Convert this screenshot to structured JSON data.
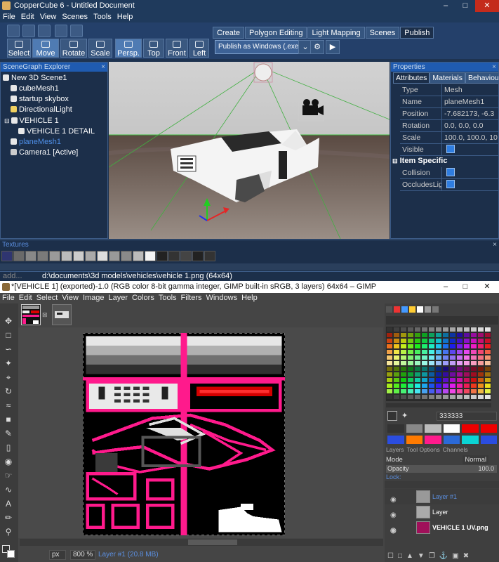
{
  "coppercube": {
    "title": "CopperCube 6 - Untitled Document",
    "menu": [
      "File",
      "Edit",
      "View",
      "Scenes",
      "Tools",
      "Help"
    ],
    "tools": [
      "Select",
      "Move",
      "Rotate",
      "Scale",
      "Persp.",
      "Top",
      "Front",
      "Left"
    ],
    "active_tools": [
      "Move",
      "Persp."
    ],
    "ribbon_tabs": [
      "Create",
      "Polygon Editing",
      "Light Mapping",
      "Scenes",
      "Publish"
    ],
    "selected_ribbon_tab": "Publish",
    "publish_target": "Publish as Windows (.exe)",
    "scene_graph": {
      "title": "SceneGraph Explorer",
      "items": [
        {
          "label": "New 3D Scene1",
          "indent": 0
        },
        {
          "label": "cubeMesh1",
          "indent": 1
        },
        {
          "label": "startup skybox",
          "indent": 1
        },
        {
          "label": "DirectionalLight",
          "indent": 1
        },
        {
          "label": "VEHICLE 1",
          "indent": 1
        },
        {
          "label": "VEHICLE 1 DETAIL",
          "indent": 2
        },
        {
          "label": "planeMesh1",
          "indent": 1,
          "selected": true
        },
        {
          "label": "Camera1 [Active]",
          "indent": 1
        }
      ]
    },
    "properties": {
      "title": "Properties",
      "tabs": [
        "Attributes",
        "Materials",
        "Behaviour"
      ],
      "rows": [
        {
          "key": "Type",
          "value": "Mesh"
        },
        {
          "key": "Name",
          "value": "planeMesh1"
        },
        {
          "key": "Position",
          "value": "-7.682173, -6.3"
        },
        {
          "key": "Rotation",
          "value": "0.0, 0.0, 0.0"
        },
        {
          "key": "Scale",
          "value": "100.0, 100.0, 10"
        },
        {
          "key": "Visible",
          "value": "checked"
        }
      ],
      "section": "Item Specific",
      "rows2": [
        {
          "key": "Collision",
          "value": "checked"
        },
        {
          "key": "OccludesLight",
          "value": "checked"
        }
      ]
    },
    "textures_title": "Textures",
    "status_left": "add...",
    "status_path": "d:\\documents\\3d models\\vehicles\\vehicle 1.png (64x64)"
  },
  "gimp": {
    "title": "*[VEHICLE 1] (exported)-1.0 (RGB color 8-bit gamma integer, GIMP built-in sRGB, 3 layers) 64x64 – GIMP",
    "menu": [
      "File",
      "Edit",
      "Select",
      "View",
      "Image",
      "Layer",
      "Colors",
      "Tools",
      "Filters",
      "Windows",
      "Help"
    ],
    "fg_hex": "333333",
    "layers_tabs": [
      "Layers",
      "Tool Options",
      "Channels"
    ],
    "mode": "Mode",
    "mode_value": "Normal",
    "opacity_label": "Opacity",
    "opacity_value": "100.0",
    "lock_label": "Lock:",
    "layers": [
      {
        "name": "Layer #1",
        "selected": true
      },
      {
        "name": "Layer",
        "selected": false
      },
      {
        "name": "VEHICLE 1 UV.png",
        "selected": false
      }
    ],
    "units": "px",
    "zoom": "800 %",
    "status": "Layer #1 (20.8 MB)"
  },
  "colors": {
    "magenta": "#ff1a8c",
    "cc_blue": "#1f5bb0",
    "gimp_bg": "#454545"
  }
}
